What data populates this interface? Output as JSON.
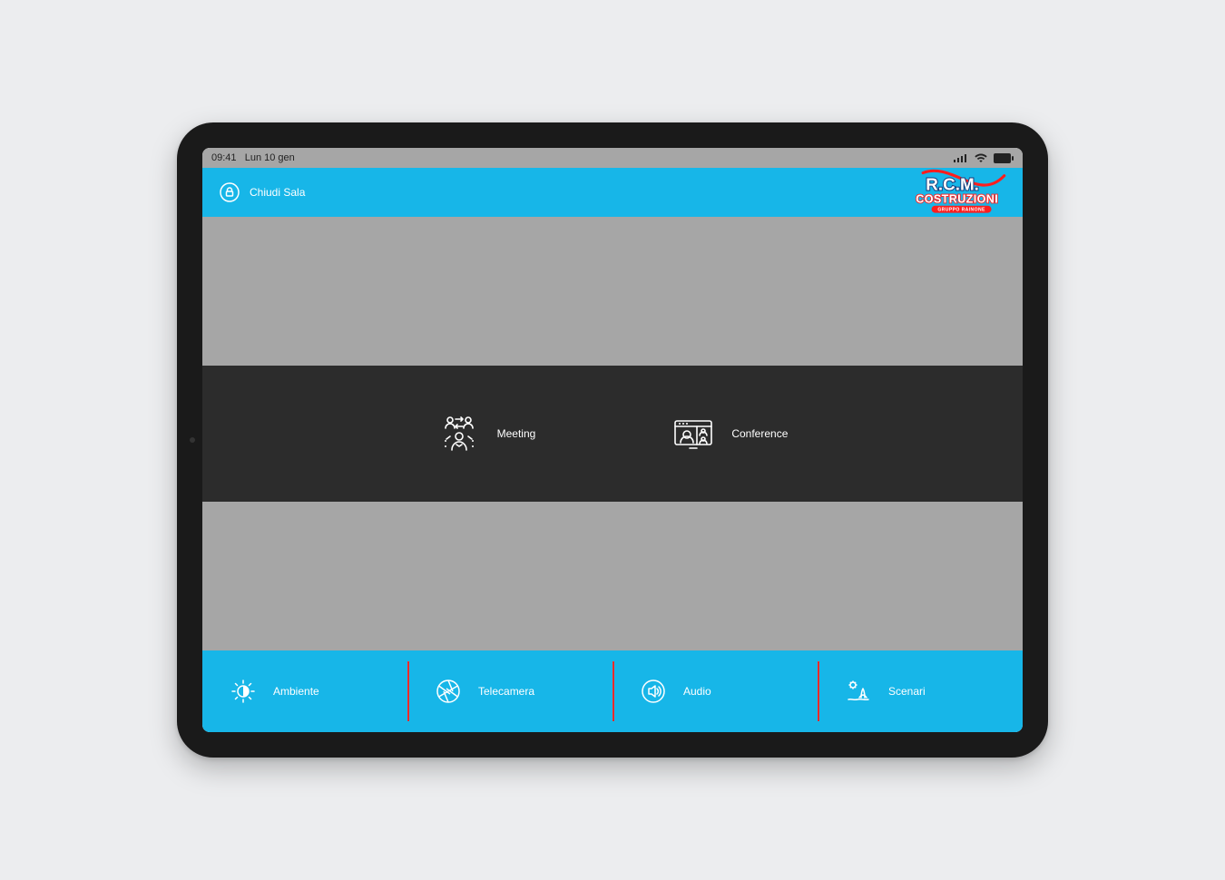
{
  "statusbar": {
    "time": "09:41",
    "date": "Lun 10 gen"
  },
  "topbar": {
    "close_room_label": "Chiudi Sala"
  },
  "brand": {
    "line1": "R.C.M.",
    "line2": "COSTRUZIONI",
    "line3": "GRUPPO RAINONE"
  },
  "modes": [
    {
      "id": "meeting",
      "label": "Meeting",
      "icon": "meeting-icon"
    },
    {
      "id": "conference",
      "label": "Conference",
      "icon": "conference-icon"
    }
  ],
  "bottom": [
    {
      "id": "ambiente",
      "label": "Ambiente",
      "icon": "brightness-icon"
    },
    {
      "id": "telecamera",
      "label": "Telecamera",
      "icon": "aperture-icon"
    },
    {
      "id": "audio",
      "label": "Audio",
      "icon": "speaker-icon"
    },
    {
      "id": "scenari",
      "label": "Scenari",
      "icon": "scene-icon"
    }
  ],
  "colors": {
    "accent": "#17b6e8",
    "dark": "#2c2c2c",
    "gray": "#a6a6a6",
    "divider": "#ff2b2b"
  }
}
